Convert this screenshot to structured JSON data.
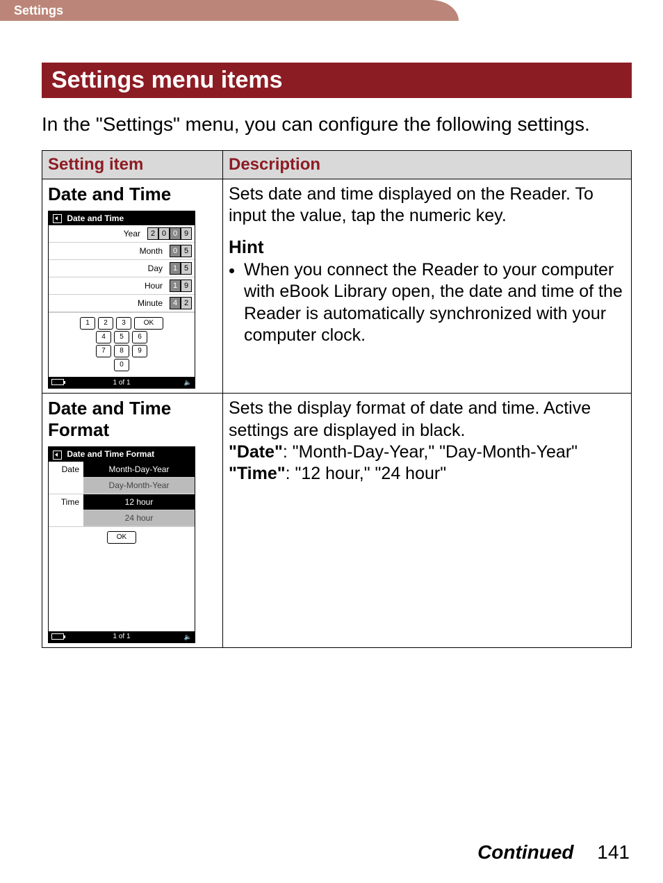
{
  "tab_label": "Settings",
  "section_title": "Settings menu items",
  "intro_text": "In the \"Settings\" menu, you can configure the following settings.",
  "table": {
    "header_item": "Setting item",
    "header_desc": "Description"
  },
  "row1": {
    "title": "Date and Time",
    "mini": {
      "title": "Date and Time",
      "year_label": "Year",
      "year_digits": [
        "2",
        "0",
        "0",
        "9"
      ],
      "year_sel_index": 2,
      "month_label": "Month",
      "month_digits": [
        "0",
        "5"
      ],
      "day_label": "Day",
      "day_digits": [
        "1",
        "5"
      ],
      "hour_label": "Hour",
      "hour_digits": [
        "1",
        "9"
      ],
      "minute_label": "Minute",
      "minute_digits": [
        "4",
        "2"
      ],
      "keys": [
        "1",
        "2",
        "3",
        "4",
        "5",
        "6",
        "7",
        "8",
        "9",
        "0"
      ],
      "ok": "OK",
      "page_indicator": "1 of 1"
    },
    "desc_main": "Sets date and time displayed on the Reader. To input the value, tap the numeric key.",
    "hint_label": "Hint",
    "hint_bullet": "When you connect the Reader to your computer with eBook Library open, the date and time of the Reader is automatically synchronized with your computer clock."
  },
  "row2": {
    "title": "Date and Time Format",
    "mini": {
      "title": "Date and Time Format",
      "date_label": "Date",
      "date_options": [
        "Month-Day-Year",
        "Day-Month-Year"
      ],
      "time_label": "Time",
      "time_options": [
        "12 hour",
        "24 hour"
      ],
      "ok": "OK",
      "page_indicator": "1 of 1"
    },
    "desc_line1": "Sets the display format of date and time. Active settings are displayed in black.",
    "date_bold": "\"Date\"",
    "date_rest": ": \"Month-Day-Year,\" \"Day-Month-Year\"",
    "time_bold": "\"Time\"",
    "time_rest": ": \"12 hour,\" \"24 hour\""
  },
  "footer": {
    "continued": "Continued",
    "page_number": "141"
  }
}
